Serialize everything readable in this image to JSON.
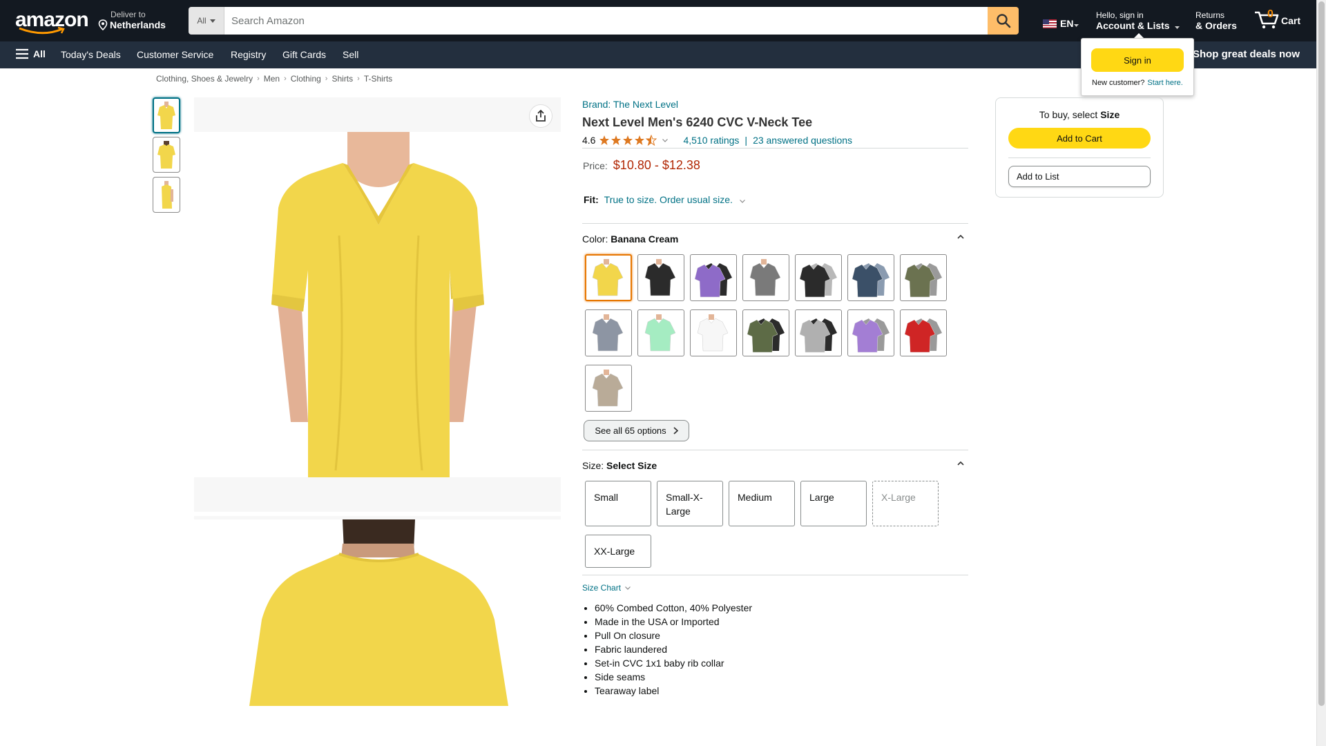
{
  "header": {
    "logo_text": "amazon",
    "deliver_to_label": "Deliver to",
    "deliver_to_location": "Netherlands",
    "search_category": "All",
    "search_placeholder": "Search Amazon",
    "language": "EN",
    "account_greeting": "Hello, sign in",
    "account_label": "Account & Lists",
    "returns_label": "Returns",
    "orders_label": "& Orders",
    "cart_count": "0",
    "cart_label": "Cart"
  },
  "subnav": {
    "all_label": "All",
    "items": [
      "Today's Deals",
      "Customer Service",
      "Registry",
      "Gift Cards",
      "Sell"
    ],
    "promo": "Shop great deals now"
  },
  "signin_flyout": {
    "button": "Sign in",
    "new_customer": "New customer?",
    "start_here": "Start here."
  },
  "breadcrumb": [
    "Clothing, Shoes & Jewelry",
    "Men",
    "Clothing",
    "Shirts",
    "T-Shirts"
  ],
  "product": {
    "brand": "Brand: The Next Level",
    "title": "Next Level Men's 6240 CVC V-Neck Tee",
    "rating_value": "4.6",
    "rating_stars": 4.5,
    "ratings_count": "4,510 ratings",
    "answered_questions": "23 answered questions",
    "price_label": "Price:",
    "price_low": "$10.80",
    "price_sep": "-",
    "price_high": "$12.38",
    "fit_label": "Fit:",
    "fit_value": "True to size. Order usual size.",
    "color_label": "Color:",
    "color_value": "Banana Cream",
    "see_all": "See all 65 options",
    "size_label": "Size:",
    "size_value": "Select Size",
    "sizes": [
      {
        "label": "Small",
        "available": true
      },
      {
        "label": "Small-X-Large",
        "available": true
      },
      {
        "label": "Medium",
        "available": true
      },
      {
        "label": "Large",
        "available": true
      },
      {
        "label": "X-Large",
        "available": false
      },
      {
        "label": "XX-Large",
        "available": true
      }
    ],
    "size_chart": "Size Chart",
    "features": [
      "60% Combed Cotton, 40% Polyester",
      "Made in the USA or Imported",
      "Pull On closure",
      "Fabric laundered",
      "Set-in CVC 1x1 baby rib collar",
      "Side seams",
      "Tearaway label"
    ]
  },
  "swatch_colors": [
    {
      "front": "#f2d64b"
    },
    {
      "front": "#2b2b2b"
    },
    {
      "front": "#8e6bc8",
      "back": "#2b2b2b"
    },
    {
      "front": "#7a7a7a"
    },
    {
      "front": "#2b2b2b",
      "back": "#b8b8b8"
    },
    {
      "front": "#3b5068",
      "back": "#8a9bb0"
    },
    {
      "front": "#6b7250",
      "back": "#9a9a9a"
    },
    {
      "front": "#8d95a3"
    },
    {
      "front": "#a5ecc2"
    },
    {
      "front": "#f7f7f7"
    },
    {
      "front": "#5d6b46",
      "back": "#2b2b2b"
    },
    {
      "front": "#b0b0b0",
      "back": "#2b2b2b"
    },
    {
      "front": "#a37ed4",
      "back": "#9a9a9a"
    },
    {
      "front": "#cf2525",
      "back": "#9a9a9a"
    },
    {
      "front": "#b9ab98"
    }
  ],
  "buybox": {
    "select_prefix": "To buy, select",
    "select_target": "Size",
    "add_to_cart": "Add to Cart",
    "add_to_list": "Add to List"
  },
  "colors": {
    "header_bg": "#131921",
    "subnav_bg": "#232f3e",
    "accent_yellow": "#ffd814",
    "search_button": "#febd69",
    "link": "#007185",
    "price": "#b12704",
    "shirt": "#f2d64b"
  }
}
